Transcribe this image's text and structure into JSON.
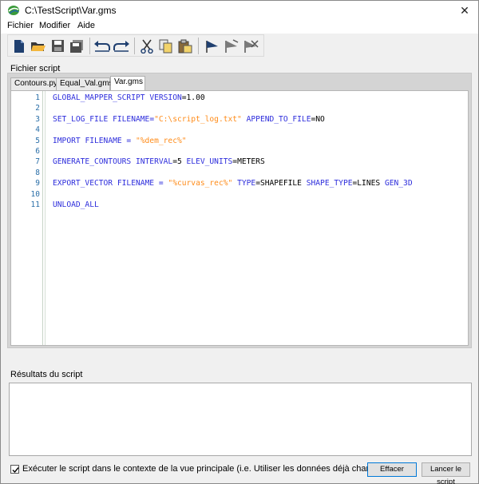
{
  "window": {
    "title": "C:\\TestScript\\Var.gms",
    "close_glyph": "✕"
  },
  "menu": {
    "items": [
      "Fichier",
      "Modifier",
      "Aide"
    ]
  },
  "toolbar": {
    "buttons": [
      {
        "name": "new-file-icon"
      },
      {
        "name": "open-folder-icon"
      },
      {
        "name": "save-icon"
      },
      {
        "name": "save-all-icon"
      },
      {
        "name": "undo-icon"
      },
      {
        "name": "redo-icon"
      },
      {
        "name": "cut-icon"
      },
      {
        "name": "copy-icon"
      },
      {
        "name": "paste-icon"
      },
      {
        "name": "run-flag-icon"
      },
      {
        "name": "run-selection-icon"
      },
      {
        "name": "stop-icon"
      }
    ]
  },
  "script_group": {
    "label": "Fichier script"
  },
  "tabs": [
    {
      "label": "Contours.py",
      "active": false
    },
    {
      "label": "Equal_Val.gms",
      "active": false
    },
    {
      "label": "Var.gms",
      "active": true
    }
  ],
  "editor": {
    "line_numbers": [
      "1",
      "2",
      "3",
      "4",
      "5",
      "6",
      "7",
      "8",
      "9",
      "10",
      "11"
    ],
    "lines": [
      [
        {
          "t": "GLOBAL_MAPPER_SCRIPT",
          "c": "kw"
        },
        {
          "t": " ",
          "c": "val"
        },
        {
          "t": "VERSION",
          "c": "kw"
        },
        {
          "t": "=1.00",
          "c": "val"
        }
      ],
      [],
      [
        {
          "t": "SET_LOG_FILE",
          "c": "kw"
        },
        {
          "t": " ",
          "c": "val"
        },
        {
          "t": "FILENAME",
          "c": "kw"
        },
        {
          "t": "=",
          "c": "op"
        },
        {
          "t": "\"C:\\script_log.txt\"",
          "c": "str"
        },
        {
          "t": " ",
          "c": "val"
        },
        {
          "t": "APPEND_TO_FILE",
          "c": "kw"
        },
        {
          "t": "=NO",
          "c": "val"
        }
      ],
      [],
      [
        {
          "t": "IMPORT",
          "c": "kw"
        },
        {
          "t": " ",
          "c": "val"
        },
        {
          "t": "FILENAME",
          "c": "kw"
        },
        {
          "t": " = ",
          "c": "op"
        },
        {
          "t": "\"%dem_rec%\"",
          "c": "str"
        }
      ],
      [],
      [
        {
          "t": "GENERATE_CONTOURS",
          "c": "kw"
        },
        {
          "t": " ",
          "c": "val"
        },
        {
          "t": "INTERVAL",
          "c": "kw"
        },
        {
          "t": "=5 ",
          "c": "val"
        },
        {
          "t": "ELEV_UNITS",
          "c": "kw"
        },
        {
          "t": "=METERS",
          "c": "val"
        }
      ],
      [],
      [
        {
          "t": "EXPORT_VECTOR",
          "c": "kw"
        },
        {
          "t": " ",
          "c": "val"
        },
        {
          "t": "FILENAME",
          "c": "kw"
        },
        {
          "t": " = ",
          "c": "op"
        },
        {
          "t": "\"%curvas_rec%\"",
          "c": "str"
        },
        {
          "t": " ",
          "c": "val"
        },
        {
          "t": "TYPE",
          "c": "kw"
        },
        {
          "t": "=SHAPEFILE ",
          "c": "val"
        },
        {
          "t": "SHAPE_TYPE",
          "c": "kw"
        },
        {
          "t": "=LINES ",
          "c": "val"
        },
        {
          "t": "GEN_3D",
          "c": "kw"
        }
      ],
      [],
      [
        {
          "t": "UNLOAD_ALL",
          "c": "kw"
        }
      ]
    ]
  },
  "results": {
    "label": "Résultats du script",
    "content": ""
  },
  "footer": {
    "checkbox_label": "Exécuter le script dans le contexte de la vue principale (i.e. Utiliser les données déjà chargées)",
    "checked": true,
    "clear_button": "Effacer",
    "run_button": "Lancer le script"
  },
  "colors": {
    "keyword": "#2e2edc",
    "string": "#ff8c1a",
    "line_number": "#2b6fa8",
    "panel": "#d4d4d4"
  }
}
